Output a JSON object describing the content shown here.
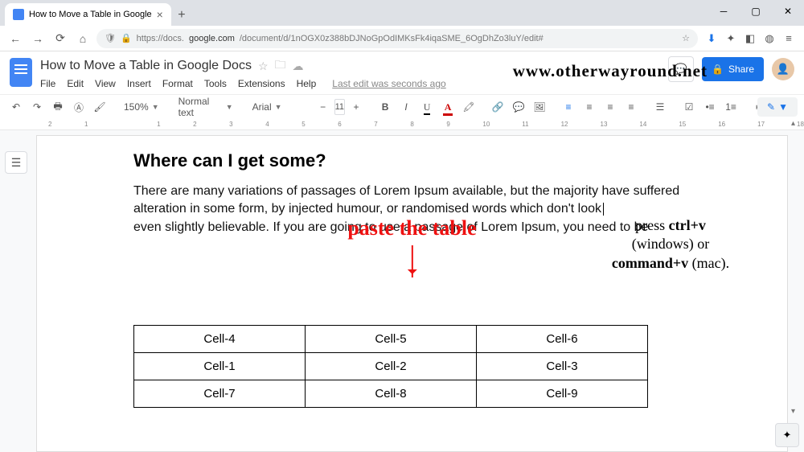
{
  "browser": {
    "tab_title": "How to Move a Table in Google",
    "url_prefix": "https://docs.",
    "url_host": "google.com",
    "url_path": "/document/d/1nOGX0z388bDJNoGpOdIMKsFk4iqaSME_6OgDhZo3luY/edit#"
  },
  "docs": {
    "title": "How to Move a Table in Google Docs",
    "menus": [
      "File",
      "Edit",
      "View",
      "Insert",
      "Format",
      "Tools",
      "Extensions",
      "Help"
    ],
    "edit_info": "Last edit was seconds ago",
    "share": "Share"
  },
  "watermark": "www.otherwayround.net",
  "toolbar": {
    "zoom": "150%",
    "style": "Normal text",
    "font": "Arial",
    "size": "11"
  },
  "ruler": [
    "2",
    "1",
    "",
    "1",
    "2",
    "3",
    "4",
    "5",
    "6",
    "7",
    "8",
    "9",
    "10",
    "11",
    "12",
    "13",
    "14",
    "15",
    "16",
    "17",
    "18"
  ],
  "content": {
    "heading": "Where can I get some?",
    "p1": "There are many variations of passages of Lorem Ipsum available, but the majority have suffered alteration in some form, by injected humour, or randomised words which don't look",
    "p2": "even slightly believable. If you are going to use a passage of Lorem Ipsum, you need to be"
  },
  "annotation": "paste the table",
  "instruction": {
    "l1a": "press ",
    "l1b": "ctrl+v",
    "l2": "(windows) or",
    "l3a": "command+v",
    "l3b": " (mac)."
  },
  "table": [
    [
      "Cell-4",
      "Cell-5",
      "Cell-6"
    ],
    [
      "Cell-1",
      "Cell-2",
      "Cell-3"
    ],
    [
      "Cell-7",
      "Cell-8",
      "Cell-9"
    ]
  ]
}
